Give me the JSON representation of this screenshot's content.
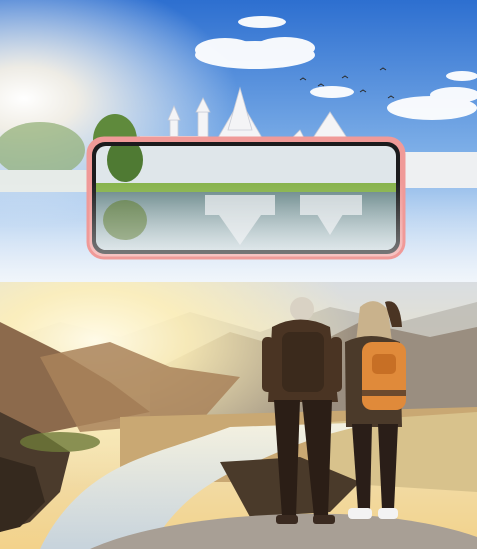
{
  "scene": {
    "top": {
      "subject": "white-temple-reflection-on-phone-screen",
      "sky_color": "#3f7fd6",
      "temple_color": "#f4f4f6",
      "phone_frame_color": "#f09a98"
    },
    "bottom": {
      "subject": "two-hikers-overlooking-mountain-valley-river",
      "sun_color": "#fff4c8",
      "mountain_color": "#8c6a4c",
      "river_color": "#dfe7ee"
    }
  }
}
